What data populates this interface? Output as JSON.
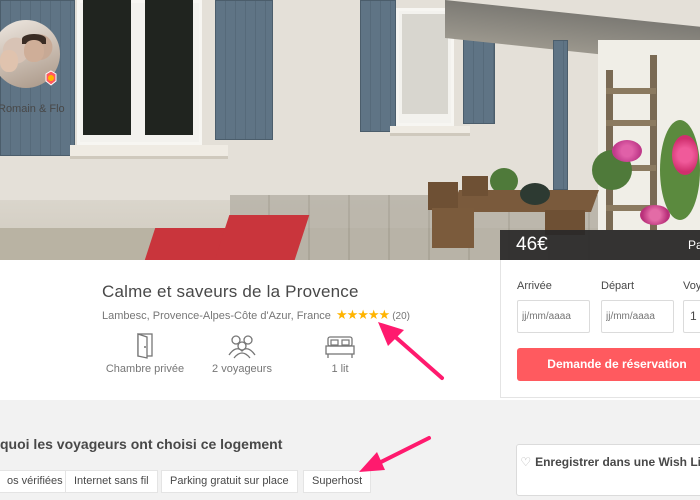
{
  "listing": {
    "price": "46€",
    "price_suffix": "Pa",
    "title": "Calme et saveurs de la Provence",
    "location": "Lambesc, Provence-Alpes-Côte d'Azur, France",
    "stars": "★★★★★",
    "rating": 5,
    "review_count": "(20)",
    "host_name": "Romain & Flo"
  },
  "amenities": [
    {
      "icon": "door-icon",
      "label": "Chambre privée"
    },
    {
      "icon": "guests-icon",
      "label": "2 voyageurs"
    },
    {
      "icon": "bed-icon",
      "label": "1 lit"
    }
  ],
  "booking": {
    "arrival_label": "Arrivée",
    "departure_label": "Départ",
    "guests_label": "Voy",
    "arrival_placeholder": "jj/mm/aaaa",
    "departure_placeholder": "jj/mm/aaaa",
    "guests_value": "1",
    "book_button": "Demande de réservation"
  },
  "why": {
    "title": "quoi les voyageurs ont choisi ce logement",
    "tags": [
      "os vérifiées",
      "Internet sans fil",
      "Parking gratuit sur place",
      "Superhost"
    ]
  },
  "wishlist": {
    "label": "Enregistrer dans une Wish List",
    "icon": "heart-icon"
  },
  "colors": {
    "accent": "#ff5a5f",
    "stars": "#ffb400",
    "annotation_arrow": "#ff1a6e",
    "shutters": "#5f7485"
  }
}
